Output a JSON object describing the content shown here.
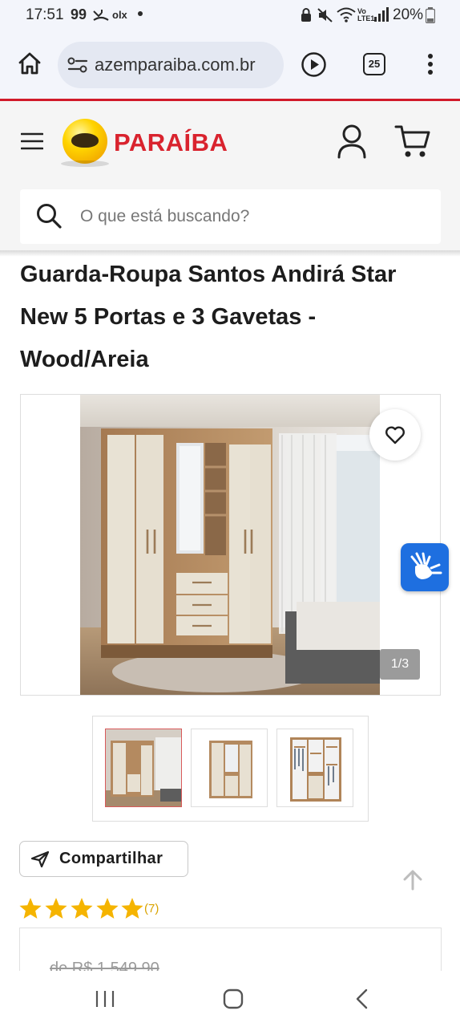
{
  "status_bar": {
    "time": "17:51",
    "notif_text": "99",
    "olx": "olx",
    "battery": "20%"
  },
  "browser": {
    "url": "azemparaiba.com.br",
    "tab_count": "25"
  },
  "site": {
    "brand_name": "PARAÍBA",
    "brand_color": "#d9232e",
    "search_placeholder": "O que está buscando?"
  },
  "product": {
    "title": "Guarda-Roupa Santos Andirá Star New 5 Portas e 3 Gavetas - Wood/Areia",
    "image_counter": "1/3",
    "share_label": "Compartilhar",
    "rating": {
      "stars": 5,
      "review_count": "(7)"
    },
    "old_price": "de R$ 1.549,90"
  },
  "icons": {
    "home": "home-icon",
    "site_info": "site-info-icon",
    "play": "play-icon",
    "tabs": "tabs-icon",
    "more": "more-vertical-icon",
    "menu": "hamburger-menu-icon",
    "account": "user-icon",
    "cart": "cart-icon",
    "search": "search-icon",
    "favorite": "heart-icon",
    "accessibility": "sign-language-icon",
    "share": "send-icon",
    "scroll_top": "arrow-up-icon"
  },
  "colors": {
    "accent_red": "#d11a2a",
    "star_gold": "#f5b400",
    "a11y_blue": "#1e6fe0"
  }
}
